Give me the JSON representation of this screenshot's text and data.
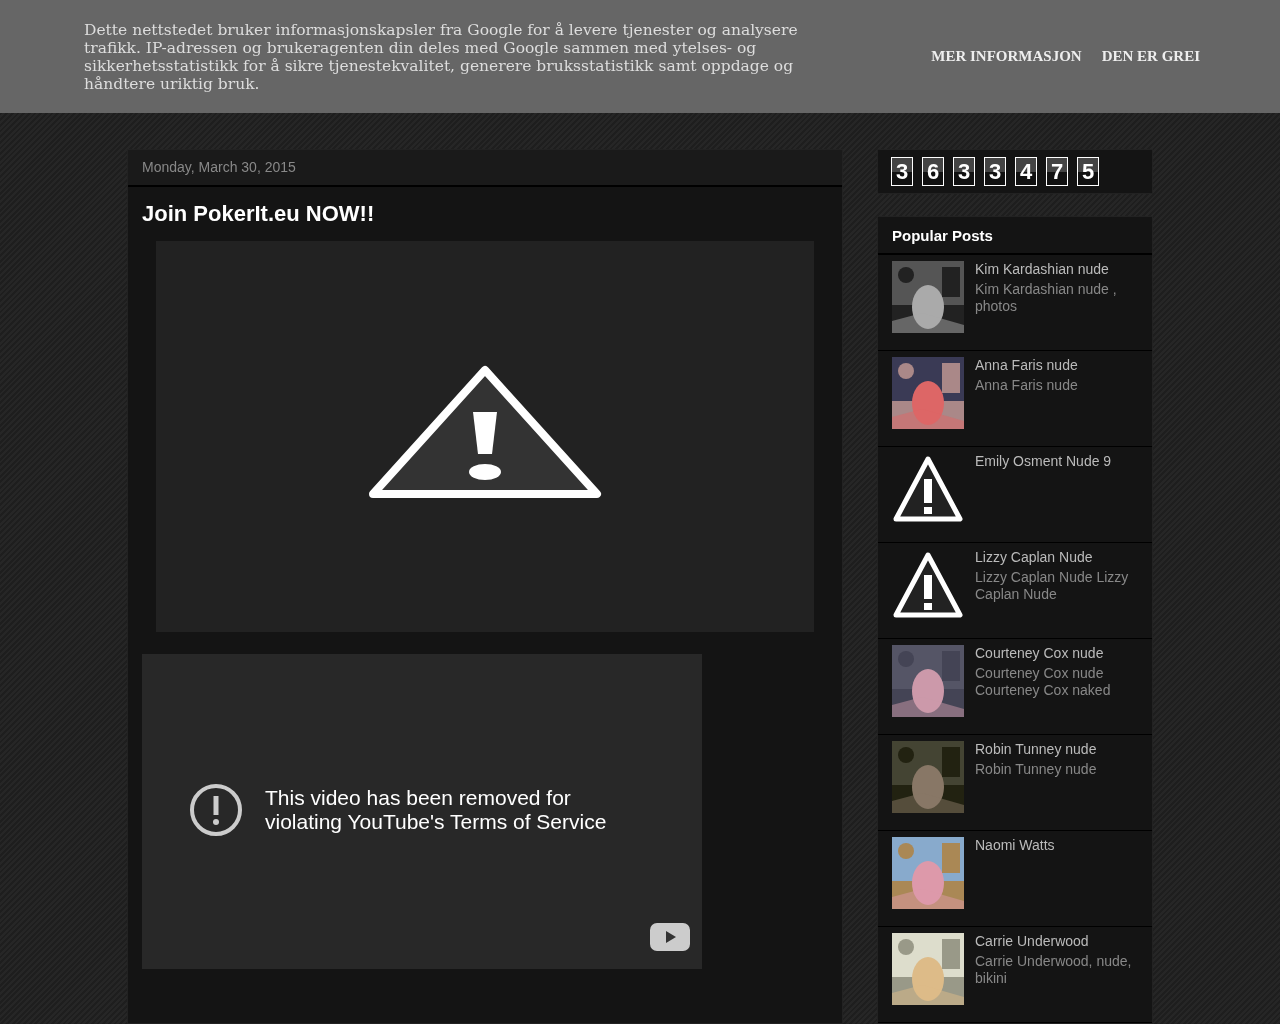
{
  "cookie_bar": {
    "message": "Dette nettstedet bruker informasjonskapsler fra Google for å levere tjenester og analysere trafikk. IP-adressen og brukeragenten din deles med Google sammen med ytelses- og sikkerhetsstatistikk for å sikre tjenestekvalitet, generere bruksstatistikk samt oppdage og håndtere uriktig bruk.",
    "buttons": [
      "MER INFORMASJON",
      "DEN ER GREI"
    ]
  },
  "post": {
    "date": "Monday, March 30, 2015",
    "title": "Join PokerIt.eu NOW!!",
    "video_message": "This video has been removed for violating YouTube's Terms of Service"
  },
  "counter": {
    "digits": [
      "3",
      "6",
      "3",
      "3",
      "4",
      "7",
      "5"
    ]
  },
  "popular_posts": {
    "title": "Popular Posts",
    "items": [
      {
        "title": "Kim Kardashian nude",
        "snippet": "Kim Kardashian nude , photos",
        "kind": "picture"
      },
      {
        "title": "Anna Faris nude",
        "snippet": "Anna Faris nude",
        "kind": "picture"
      },
      {
        "title": "Emily Osment Nude 9",
        "kind": "warning"
      },
      {
        "title": "Lizzy Caplan Nude",
        "snippet": "Lizzy Caplan Nude Lizzy Caplan Nude",
        "kind": "warning"
      },
      {
        "title": "Courteney Cox nude",
        "snippet": "Courteney Cox nude Courteney Cox naked",
        "kind": "picture"
      },
      {
        "title": "Robin Tunney nude",
        "snippet": "Robin Tunney nude",
        "kind": "picture"
      },
      {
        "title": "Naomi Watts",
        "kind": "picture"
      },
      {
        "title": "Carrie Underwood",
        "snippet": "Carrie Underwood, nude, bikini",
        "kind": "picture"
      }
    ]
  }
}
